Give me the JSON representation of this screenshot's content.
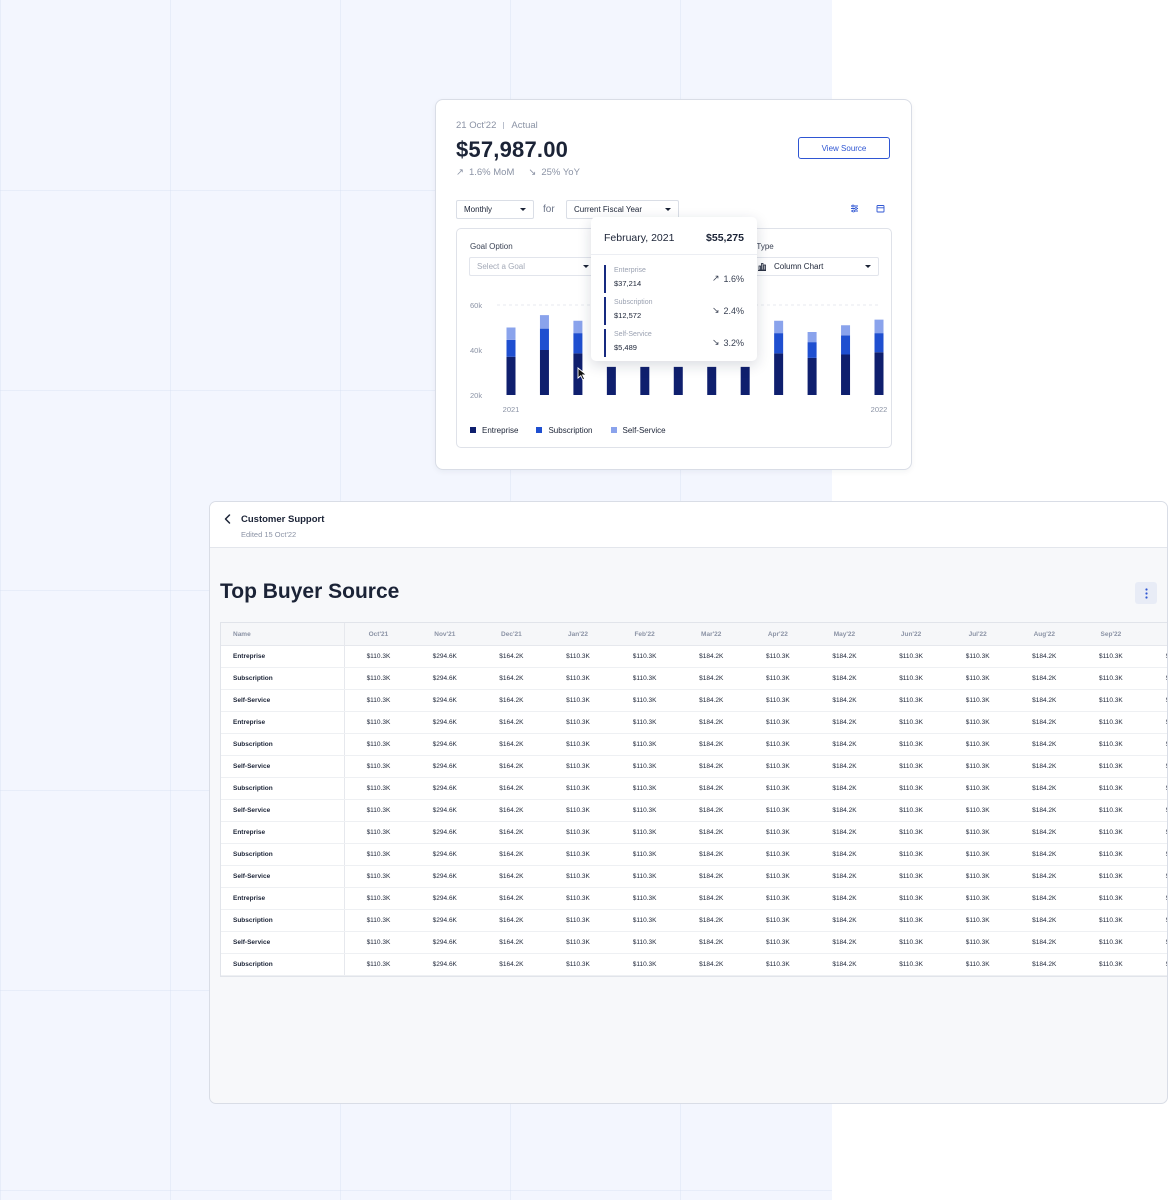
{
  "card": {
    "date": "21 Oct'22",
    "status": "Actual",
    "amount": "$57,987.00",
    "mom": "1.6% MoM",
    "yoy": "25% YoY",
    "view_source": "View Source",
    "period_select": "Monthly",
    "for_label": "for",
    "range_select": "Current Fiscal Year",
    "goal_label": "Goal Option",
    "goal_placeholder": "Select a Goal",
    "chart_type_label": "art Type",
    "chart_type_value": "Column Chart"
  },
  "chart_data": {
    "type": "bar",
    "stacked": true,
    "x_labels": [
      "2021",
      "2022"
    ],
    "yticks": [
      "60k",
      "40k",
      "20k"
    ],
    "ylim": [
      20000,
      60000
    ],
    "grid": "dashed line at top",
    "categories": [
      "1",
      "2",
      "3",
      "4",
      "5",
      "6",
      "7",
      "8",
      "9",
      "10",
      "11",
      "12"
    ],
    "series": [
      {
        "name": "Entreprise",
        "color": "#0f1f6e",
        "values": [
          37000,
          40000,
          38500,
          32500,
          32500,
          32500,
          32500,
          32500,
          38500,
          36500,
          38000,
          39000
        ]
      },
      {
        "name": "Subscription",
        "color": "#1f4fd0",
        "values": [
          7500,
          9500,
          9000,
          0,
          0,
          0,
          0,
          0,
          9000,
          7000,
          8500,
          8500
        ]
      },
      {
        "name": "Self-Service",
        "color": "#8aa3ec",
        "values": [
          5500,
          6000,
          5500,
          0,
          0,
          0,
          0,
          0,
          5500,
          4500,
          4500,
          6000
        ]
      }
    ],
    "legend_position": "bottom-left"
  },
  "tooltip": {
    "month": "February, 2021",
    "total": "$55,275",
    "rows": [
      {
        "name": "Enterprise",
        "amount": "$37,214",
        "pct": "1.6%",
        "dir": "up"
      },
      {
        "name": "Subscription",
        "amount": "$12,572",
        "pct": "2.4%",
        "dir": "down"
      },
      {
        "name": "Self-Service",
        "amount": "$5,489",
        "pct": "3.2%",
        "dir": "down"
      }
    ]
  },
  "panel": {
    "title": "Customer Support",
    "subtitle": "Edited 15 Oct'22",
    "heading": "Top Buyer Source",
    "table": {
      "name_header": "Name",
      "columns": [
        "Oct'21",
        "Nov'21",
        "Dec'21",
        "Jan'22",
        "Feb'22",
        "Mar'22",
        "Apr'22",
        "May'22",
        "Jun'22",
        "Jul'22",
        "Aug'22",
        "Sep'22",
        "<"
      ],
      "row_values": [
        "$110.3K",
        "$294.6K",
        "$164.2K",
        "$110.3K",
        "$110.3K",
        "$184.2K",
        "$110.3K",
        "$184.2K",
        "$110.3K",
        "$110.3K",
        "$184.2K",
        "$110.3K",
        "$110.3K"
      ],
      "row_names": [
        "Entreprise",
        "Subscription",
        "Self-Service",
        "Entreprise",
        "Subscription",
        "Self-Service",
        "Subscription",
        "Self-Service",
        "Entreprise",
        "Subscription",
        "Self-Service",
        "Entreprise",
        "Subscription",
        "Self-Service",
        "Subscription"
      ]
    }
  }
}
